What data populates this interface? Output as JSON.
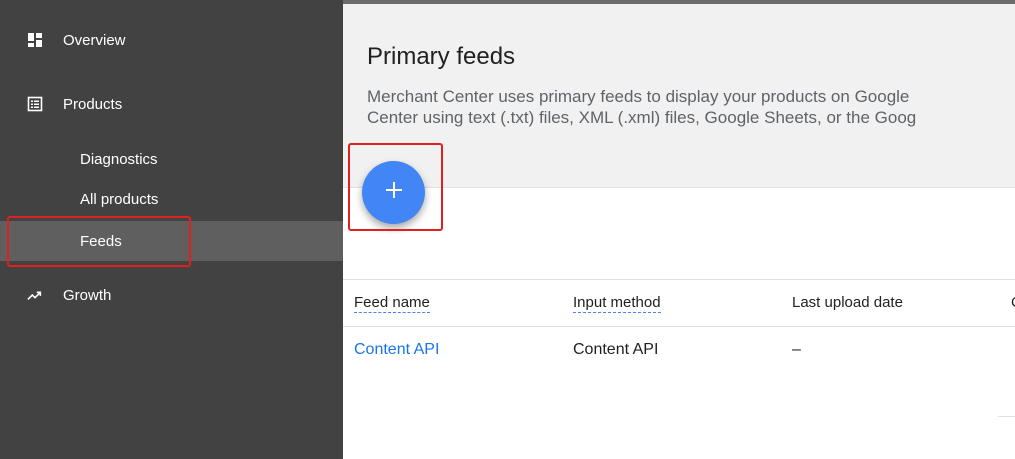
{
  "sidebar": {
    "items": [
      {
        "label": "Overview",
        "icon": "dashboard-icon"
      },
      {
        "label": "Products",
        "icon": "list-icon"
      },
      {
        "label": "Diagnostics"
      },
      {
        "label": "All products"
      },
      {
        "label": "Feeds"
      },
      {
        "label": "Growth",
        "icon": "trending-up-icon"
      }
    ]
  },
  "main": {
    "title": "Primary feeds",
    "description_line1": "Merchant Center uses primary feeds to display your products on Google",
    "description_line2": "Center using text (.txt) files, XML (.xml) files, Google Sheets, or the Goog",
    "add_button_icon": "plus-icon",
    "table": {
      "headers": [
        "Feed name",
        "Input method",
        "Last upload date",
        "C"
      ],
      "rows": [
        {
          "feed_name": "Content API",
          "input_method": "Content API",
          "last_upload": "–"
        }
      ]
    }
  },
  "colors": {
    "sidebar_bg": "#424242",
    "active_item_bg": "#5f5f5f",
    "fab_blue": "#4285f4",
    "link_blue": "#1a73e8",
    "highlight_red": "#e02020"
  }
}
